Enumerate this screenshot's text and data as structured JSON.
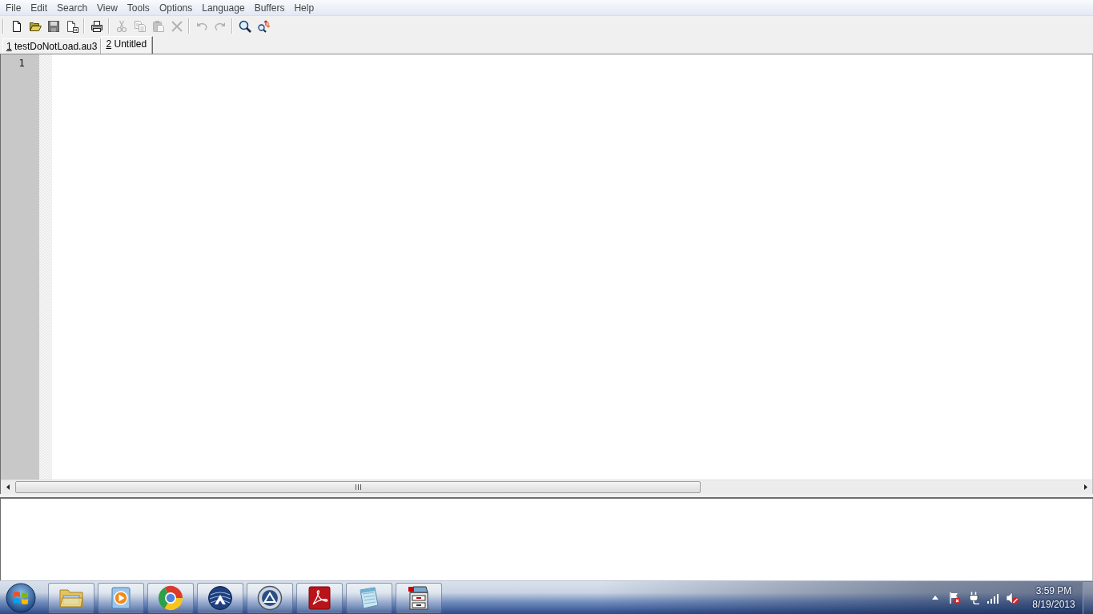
{
  "menu": [
    "File",
    "Edit",
    "Search",
    "View",
    "Tools",
    "Options",
    "Language",
    "Buffers",
    "Help"
  ],
  "toolbar": {
    "groups": [
      [
        {
          "disabled": false
        },
        {
          "disabled": false
        },
        {
          "disabled": false
        },
        {
          "disabled": false
        }
      ],
      [
        {
          "disabled": false
        }
      ],
      [
        {
          "disabled": true
        },
        {
          "disabled": true
        },
        {
          "disabled": true
        },
        {
          "disabled": true
        }
      ],
      [
        {
          "disabled": true
        },
        {
          "disabled": true
        }
      ],
      [
        {
          "disabled": false
        },
        {
          "disabled": false
        }
      ]
    ]
  },
  "tabs": [
    {
      "key": "1",
      "label": "testDoNotLoad.au3",
      "selected": false
    },
    {
      "key": "2",
      "label": "Untitled",
      "selected": true
    }
  ],
  "editor": {
    "line_numbers": [
      "1"
    ]
  },
  "taskbar": {
    "tray": {
      "volume_muted": true
    },
    "clock": {
      "time": "3:59 PM",
      "date": "8/19/2013"
    }
  }
}
